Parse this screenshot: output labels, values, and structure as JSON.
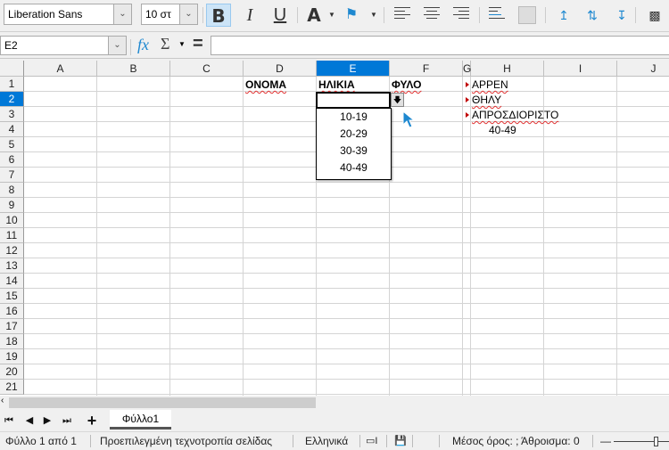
{
  "toolbar": {
    "font_name": "Liberation Sans",
    "font_size": "10 στ",
    "bold": "B",
    "italic": "I",
    "underline": "U",
    "font_color": "A"
  },
  "formula_bar": {
    "name_box": "E2",
    "fx": "fx",
    "sum": "Σ",
    "equals": "=",
    "input_value": ""
  },
  "columns": [
    "A",
    "B",
    "C",
    "D",
    "E",
    "F",
    "G",
    "H",
    "I",
    "J"
  ],
  "rows": [
    "1",
    "2",
    "3",
    "4",
    "5",
    "6",
    "7",
    "8",
    "9",
    "10",
    "11",
    "12",
    "13",
    "14",
    "15",
    "16",
    "17",
    "18",
    "19",
    "20",
    "21"
  ],
  "cells": {
    "D1": "ΟΝΟΜΑ",
    "E1": "ΗΛΙΚΙΑ",
    "F1": "ΦΥΛΟ",
    "H1": "ΑΡΡΕΝ",
    "H2": "ΘΗΛΥ",
    "H3": "ΑΠΡΟΣΔΙΟΡΙΣΤΟ",
    "H4": "40-49"
  },
  "dropdown": {
    "options": [
      "10-19",
      "20-29",
      "30-39",
      "40-49"
    ]
  },
  "sheet_tabs": {
    "active": "Φύλλο1",
    "add": "+"
  },
  "status": {
    "sheet": "Φύλλο 1 από 1",
    "page_style": "Προεπιλεγμένη τεχνοτροπία σελίδας",
    "language": "Ελληνικά",
    "summary": "Μέσος όρος: ; Άθροισμα: 0"
  },
  "colors": {
    "accent": "#0078d7",
    "spell_error": "#e03030",
    "comment_mark": "#c00000"
  }
}
